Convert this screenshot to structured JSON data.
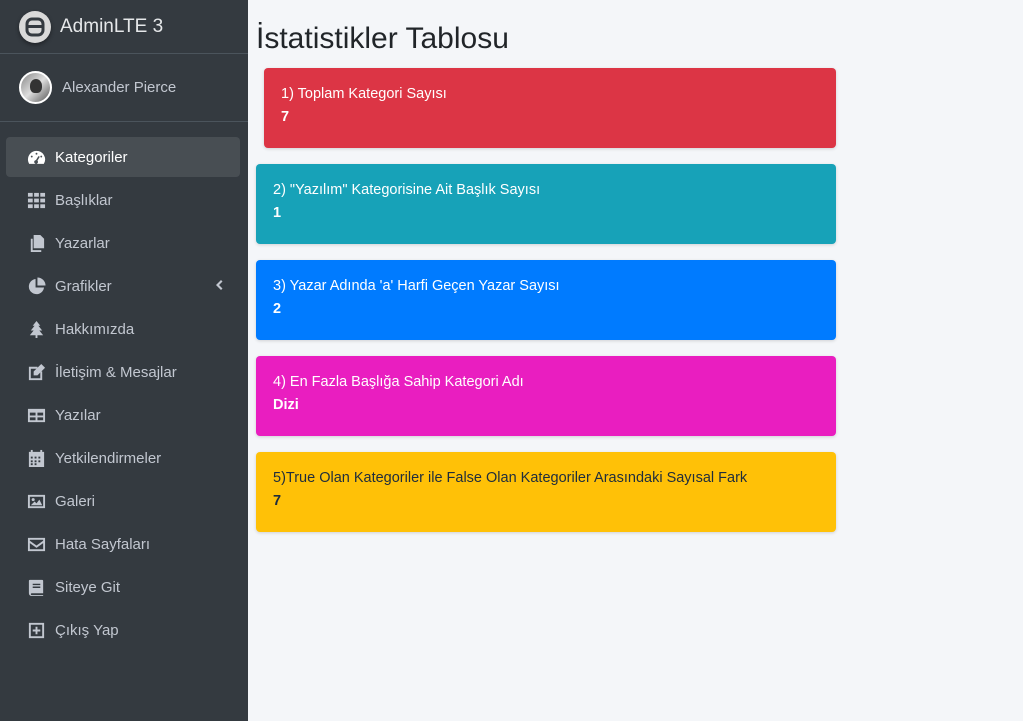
{
  "brand": {
    "name": "AdminLTE 3"
  },
  "user": {
    "name": "Alexander Pierce"
  },
  "sidebar": {
    "items": [
      {
        "label": "Kategoriler",
        "icon": "tachometer-icon"
      },
      {
        "label": "Başlıklar",
        "icon": "grid-icon"
      },
      {
        "label": "Yazarlar",
        "icon": "copy-icon"
      },
      {
        "label": "Grafikler",
        "icon": "pie-chart-icon"
      },
      {
        "label": "Hakkımızda",
        "icon": "tree-icon"
      },
      {
        "label": "İletişim & Mesajlar",
        "icon": "edit-icon"
      },
      {
        "label": "Yazılar",
        "icon": "table-icon"
      },
      {
        "label": "Yetkilendirmeler",
        "icon": "calendar-icon"
      },
      {
        "label": "Galeri",
        "icon": "image-icon"
      },
      {
        "label": "Hata Sayfaları",
        "icon": "envelope-icon"
      },
      {
        "label": "Siteye Git",
        "icon": "book-icon"
      },
      {
        "label": "Çıkış Yap",
        "icon": "plus-square-icon"
      }
    ]
  },
  "main": {
    "title": "İstatistikler Tablosu",
    "cards": [
      {
        "label": "1) Toplam Kategori Sayısı",
        "value": "7",
        "color": "#dc3545"
      },
      {
        "label": "2) \"Yazılım\" Kategorisine Ait Başlık Sayısı",
        "value": "1",
        "color": "#17a2b8"
      },
      {
        "label": "3) Yazar Adında 'a' Harfi Geçen Yazar Sayısı",
        "value": "2",
        "color": "#007bff"
      },
      {
        "label": "4) En Fazla Başlığa Sahip Kategori Adı",
        "value": "Dizi",
        "color": "#e91ec0"
      },
      {
        "label": "5)True Olan Kategoriler ile False Olan Kategoriler Arasındaki Sayısal Fark",
        "value": "7",
        "color": "#ffc107"
      }
    ]
  }
}
